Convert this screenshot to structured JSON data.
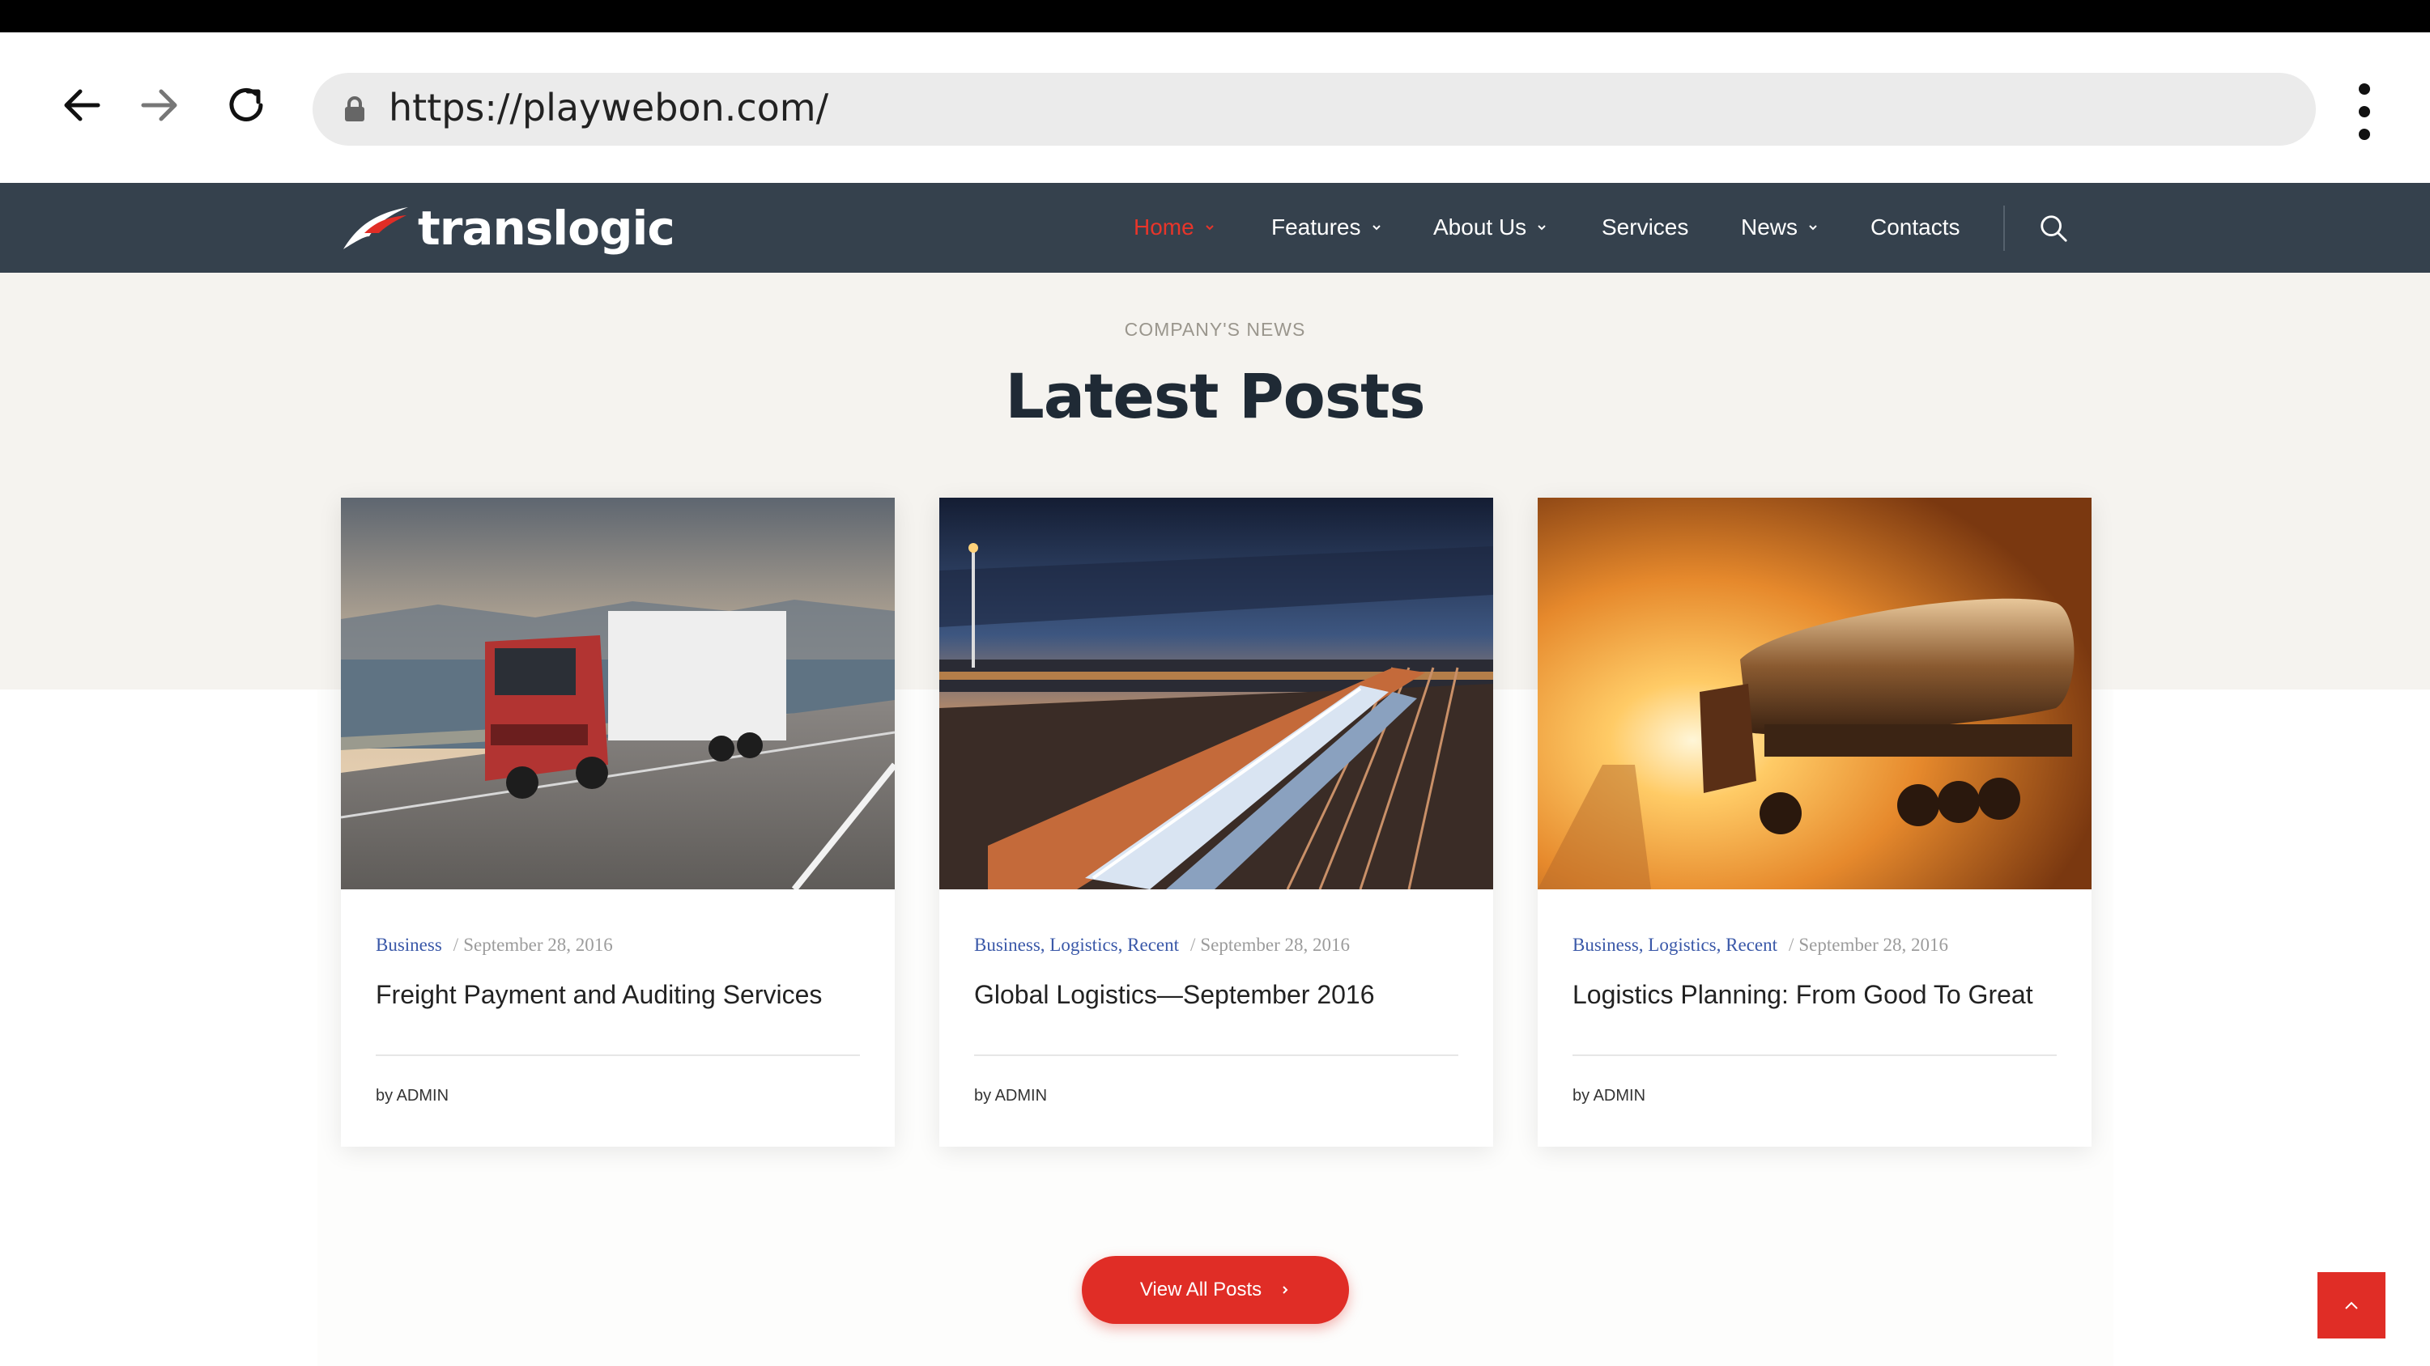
{
  "browser": {
    "url": "https://playwebon.com/",
    "back_icon": "arrow-left-icon",
    "forward_icon": "arrow-right-icon",
    "reload_icon": "reload-icon",
    "menu_icon": "kebab-menu-icon",
    "lock_icon": "lock-icon"
  },
  "site": {
    "logo_text": "translogic",
    "nav": [
      {
        "label": "Home",
        "active": true,
        "has_caret": true
      },
      {
        "label": "Features",
        "active": false,
        "has_caret": true
      },
      {
        "label": "About Us",
        "active": false,
        "has_caret": true
      },
      {
        "label": "Services",
        "active": false,
        "has_caret": false
      },
      {
        "label": "News",
        "active": false,
        "has_caret": true
      },
      {
        "label": "Contacts",
        "active": false,
        "has_caret": false
      }
    ],
    "search_icon": "search-icon"
  },
  "section": {
    "eyebrow": "COMPANY'S NEWS",
    "title": "Latest Posts"
  },
  "posts": [
    {
      "categories": [
        "Business"
      ],
      "date": "September 28, 2016",
      "title": "Freight Payment and Auditing Services",
      "author": "by ADMIN"
    },
    {
      "categories": [
        "Business",
        "Logistics",
        "Recent"
      ],
      "date": "September 28, 2016",
      "title": "Global Logistics—September 2016",
      "author": "by ADMIN"
    },
    {
      "categories": [
        "Business",
        "Logistics",
        "Recent"
      ],
      "date": "September 28, 2016",
      "title": "Logistics Planning: From Good To Great",
      "author": "by ADMIN"
    }
  ],
  "view_all_label": "View All Posts",
  "colors": {
    "header_bg": "#35414d",
    "accent": "#e02d26",
    "active_nav": "#e8352a",
    "category_link": "#3a58a8"
  }
}
